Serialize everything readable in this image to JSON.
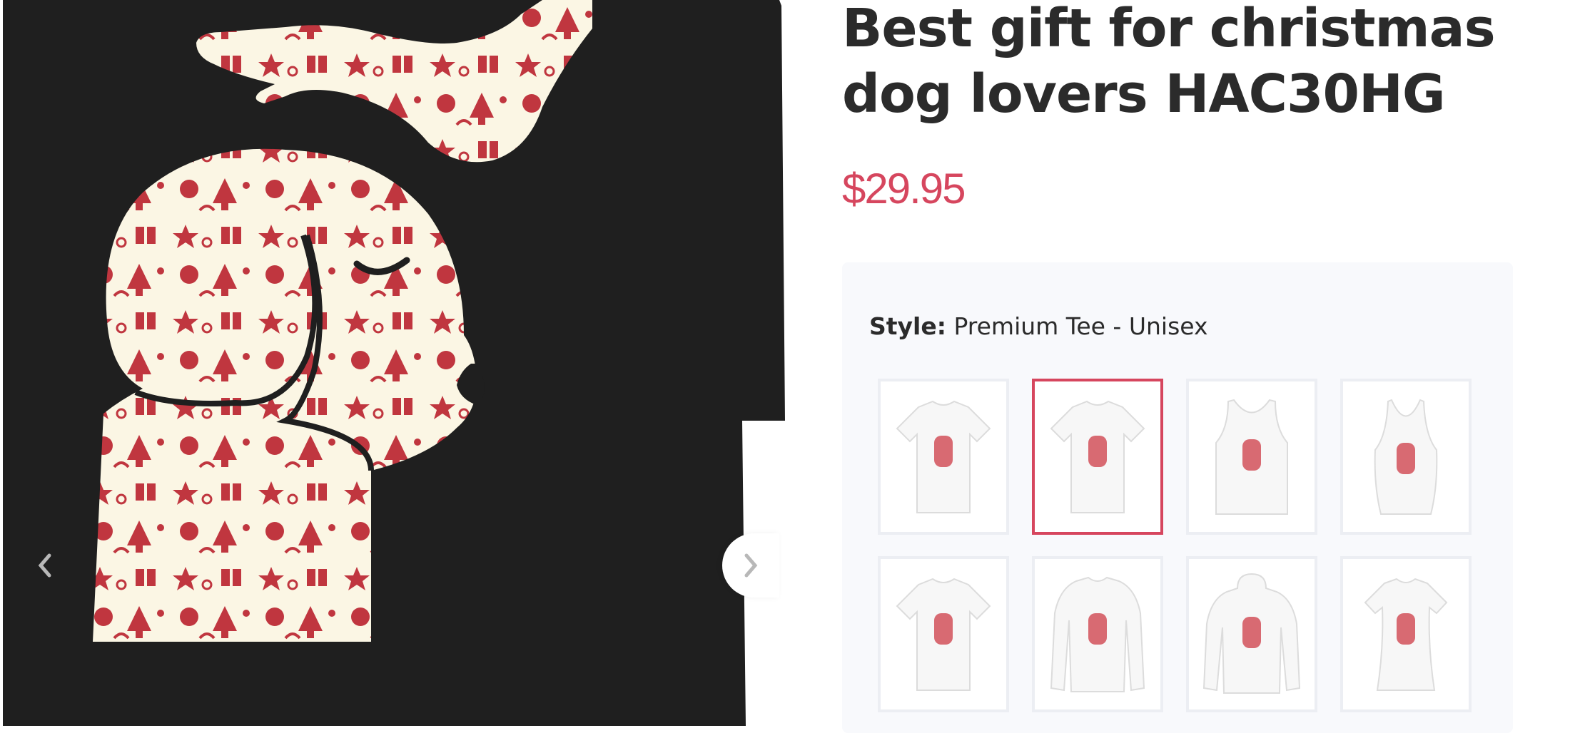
{
  "product": {
    "title": "Best gift for christmas dog lovers HAC30HG",
    "price": "$29.95"
  },
  "gallery": {
    "prev_icon": "chevron-left-icon",
    "next_icon": "chevron-right-icon"
  },
  "style": {
    "label": "Style:",
    "value": "Premium Tee - Unisex",
    "options": [
      {
        "type": "tee",
        "selected": false
      },
      {
        "type": "tee",
        "selected": true
      },
      {
        "type": "tank",
        "selected": false
      },
      {
        "type": "racerback-tank",
        "selected": false
      },
      {
        "type": "youth-tee",
        "selected": false
      },
      {
        "type": "long-sleeve",
        "selected": false
      },
      {
        "type": "hoodie",
        "selected": false
      },
      {
        "type": "ladies-tee",
        "selected": false
      }
    ]
  },
  "colors": {
    "accent": "#d6465e",
    "title": "#2b2b2b",
    "shirt": "#1f1f1f",
    "print_red": "#c0363f",
    "print_cream": "#fbf6e4"
  }
}
